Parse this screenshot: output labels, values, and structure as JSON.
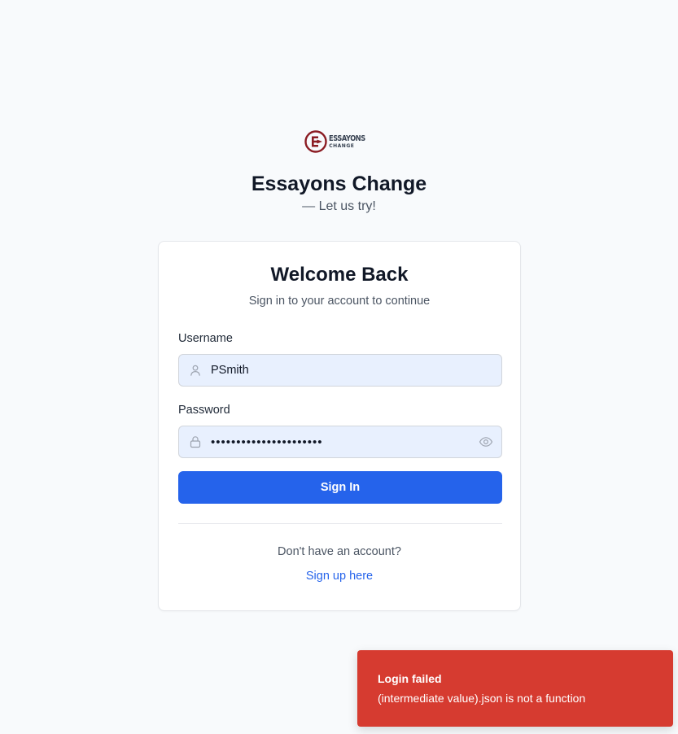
{
  "brand": {
    "logo_line1": "ESSAYONS",
    "logo_line2": "CHANGE",
    "title": "Essayons Change",
    "tagline": "— Let us try!",
    "logo_color": "#8b1c23"
  },
  "card": {
    "title": "Welcome Back",
    "subtitle": "Sign in to your account to continue"
  },
  "form": {
    "username_label": "Username",
    "username_value": "PSmith",
    "password_label": "Password",
    "password_value": "••••••••••••••••••••••",
    "sign_in_label": "Sign In",
    "user_icon": "user-icon",
    "lock_icon": "lock-icon",
    "eye_icon": "eye-icon"
  },
  "footer": {
    "prompt": "Don't have an account?",
    "signup_label": "Sign up here"
  },
  "toast": {
    "title": "Login failed",
    "message": "(intermediate value).json is not a function",
    "color": "#d63b30"
  },
  "colors": {
    "primary": "#2563eb",
    "input_bg": "#e8f0fe",
    "page_bg": "#f8fafc"
  }
}
